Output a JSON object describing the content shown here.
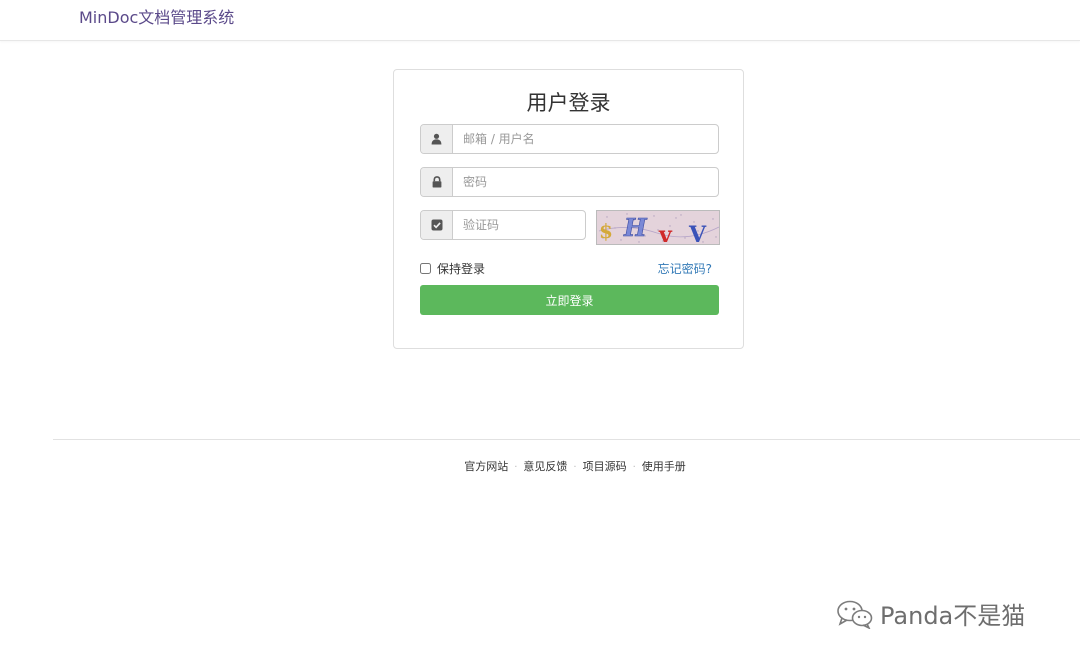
{
  "header": {
    "brand": "MinDoc文档管理系统"
  },
  "login": {
    "title": "用户登录",
    "account_placeholder": "邮箱 / 用户名",
    "password_placeholder": "密码",
    "captcha_placeholder": "验证码",
    "captcha_text": "$HvV",
    "remember_label": "保持登录",
    "forgot_label": "忘记密码?",
    "submit_label": "立即登录"
  },
  "footer": {
    "links": [
      "官方网站",
      "意见反馈",
      "项目源码",
      "使用手册"
    ],
    "separator": "·"
  },
  "watermark": {
    "text": "Panda不是猫"
  },
  "colors": {
    "brand": "#5b4a8a",
    "primary_button": "#5cb85c",
    "link": "#337ab7"
  },
  "icons": {
    "account": "user-icon",
    "password": "lock-icon",
    "captcha": "check-square-icon",
    "watermark": "wechat-icon"
  }
}
